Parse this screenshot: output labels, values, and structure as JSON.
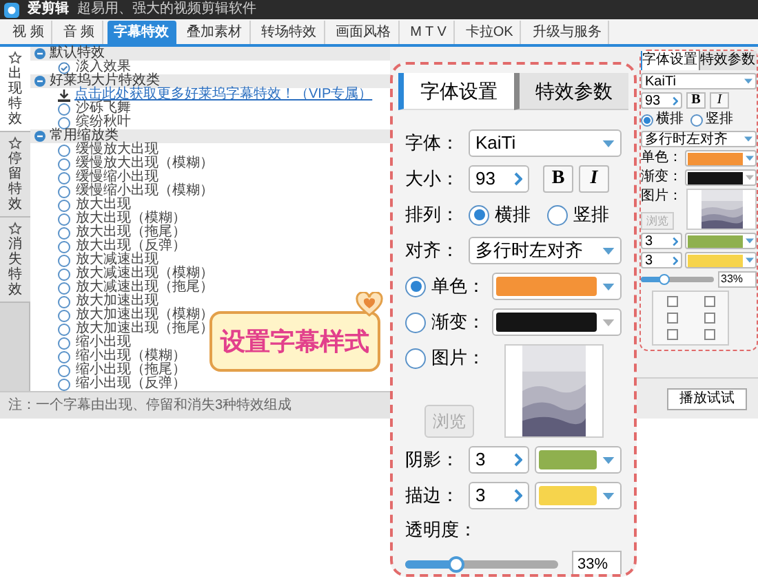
{
  "window": {
    "app_name": "爱剪辑",
    "tagline": "超易用、强大的视频剪辑软件"
  },
  "tabs": [
    {
      "label": "视 频",
      "selected": false
    },
    {
      "label": "音 频",
      "selected": false
    },
    {
      "label": "字幕特效",
      "selected": true
    },
    {
      "label": "叠加素材",
      "selected": false
    },
    {
      "label": "转场特效",
      "selected": false
    },
    {
      "label": "画面风格",
      "selected": false
    },
    {
      "label": "M T V",
      "selected": false
    },
    {
      "label": "卡拉OK",
      "selected": false
    },
    {
      "label": "升级与服务",
      "selected": false
    }
  ],
  "side_tabs": [
    {
      "label": "出现特效",
      "selected": true
    },
    {
      "label": "停留特效",
      "selected": false
    },
    {
      "label": "消失特效",
      "selected": false
    }
  ],
  "effect_groups": [
    {
      "title": "默认特效",
      "expanded": true,
      "items": [
        {
          "kind": "check",
          "label": "淡入效果",
          "selected": true
        }
      ]
    },
    {
      "title": "好莱坞大片特效类",
      "expanded": true,
      "items": [
        {
          "kind": "link",
          "label": "点击此处获取更多好莱坞字幕特效！（VIP专属）"
        },
        {
          "kind": "option",
          "label": "沙砾飞舞",
          "selected": false
        },
        {
          "kind": "option",
          "label": "缤纷秋叶",
          "selected": false
        }
      ]
    },
    {
      "title": "常用缩放类",
      "expanded": true,
      "items": [
        {
          "kind": "option",
          "label": "缓慢放大出现",
          "selected": false
        },
        {
          "kind": "option",
          "label": "缓慢放大出现（模糊）",
          "selected": false
        },
        {
          "kind": "option",
          "label": "缓慢缩小出现",
          "selected": false
        },
        {
          "kind": "option",
          "label": "缓慢缩小出现（模糊）",
          "selected": false
        },
        {
          "kind": "option",
          "label": "放大出现",
          "selected": false
        },
        {
          "kind": "option",
          "label": "放大出现（模糊）",
          "selected": false
        },
        {
          "kind": "option",
          "label": "放大出现（拖尾）",
          "selected": false
        },
        {
          "kind": "option",
          "label": "放大出现（反弹）",
          "selected": false
        },
        {
          "kind": "option",
          "label": "放大减速出现",
          "selected": false
        },
        {
          "kind": "option",
          "label": "放大减速出现（模糊）",
          "selected": false
        },
        {
          "kind": "option",
          "label": "放大减速出现（拖尾）",
          "selected": false
        },
        {
          "kind": "option",
          "label": "放大加速出现",
          "selected": false
        },
        {
          "kind": "option",
          "label": "放大加速出现（模糊）",
          "selected": false
        },
        {
          "kind": "option",
          "label": "放大加速出现（拖尾）",
          "selected": false
        },
        {
          "kind": "option",
          "label": "缩小出现",
          "selected": false
        },
        {
          "kind": "option",
          "label": "缩小出现（模糊）",
          "selected": false
        },
        {
          "kind": "option",
          "label": "缩小出现（拖尾）",
          "selected": false
        },
        {
          "kind": "option",
          "label": "缩小出现（反弹）",
          "selected": false
        }
      ]
    }
  ],
  "note": "注：一个字幕由出现、停留和消失3种特效组成",
  "side_panel": {
    "tabs": [
      {
        "label": "字体设置",
        "selected": true
      },
      {
        "label": "特效参数",
        "selected": false
      }
    ],
    "font": "KaiTi",
    "size": "93",
    "bold": "B",
    "italic": "I",
    "arrangement": [
      {
        "label": "横排",
        "selected": true
      },
      {
        "label": "竖排",
        "selected": false
      }
    ],
    "align": "多行时左对齐",
    "fills": [
      {
        "kind": "color",
        "label": "单色：",
        "color": "#f39237"
      },
      {
        "kind": "gradient",
        "label": "渐变：",
        "color": "#151515",
        "disabled": true
      },
      {
        "label": "图片："
      }
    ],
    "browse": {
      "label": "浏览",
      "disabled": true
    },
    "shadow": {
      "value": "3",
      "color": "#8fb04e"
    },
    "stroke": {
      "value": "3",
      "color": "#f6d44c"
    },
    "opacity": {
      "level": 0.33,
      "reading": "33%"
    },
    "position_grid": [
      {
        "checked": false
      },
      {
        "checked": false
      },
      {
        "checked": false
      },
      {
        "checked": false
      },
      {
        "checked": false
      },
      {
        "checked": false
      }
    ]
  },
  "play_button": "播放试试",
  "sticker": {
    "text": "设置字幕样式"
  },
  "callout": {
    "tabs": [
      {
        "label": "字体设置",
        "selected": true
      },
      {
        "label": "特效参数",
        "selected": false
      }
    ],
    "font": {
      "label": "字体：",
      "value": "KaiTi"
    },
    "size": {
      "label": "大小：",
      "value": "93"
    },
    "bold": "B",
    "italic": "I",
    "arrangement": {
      "label": "排列：",
      "options": [
        {
          "label": "横排",
          "selected": true
        },
        {
          "label": "竖排",
          "selected": false
        }
      ]
    },
    "align": {
      "label": "对齐：",
      "value": "多行时左对齐"
    },
    "fills": [
      {
        "kind": "color",
        "label": "单色：",
        "selected": true,
        "color": "#f39237"
      },
      {
        "kind": "gradient",
        "label": "渐变：",
        "selected": false,
        "color": "#151515",
        "disabled": true
      },
      {
        "label": "图片：",
        "selected": false
      }
    ],
    "browse": {
      "label": "浏览",
      "disabled": true
    },
    "shadow": {
      "label": "阴影：",
      "value": "3",
      "color": "#8fb04e"
    },
    "stroke": {
      "label": "描边：",
      "value": "3",
      "color": "#f6d44c"
    },
    "opacity": {
      "label": "透明度：",
      "level": 0.33,
      "reading": "33%"
    }
  }
}
